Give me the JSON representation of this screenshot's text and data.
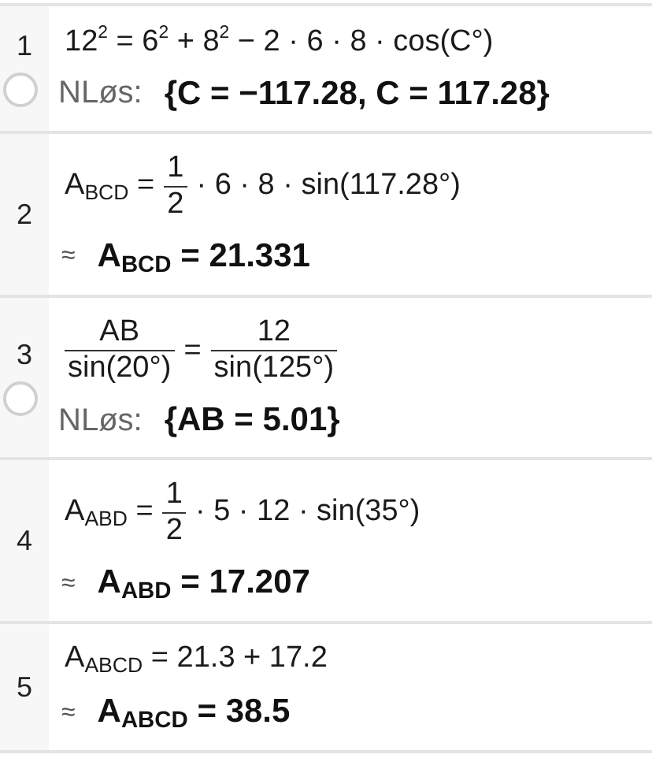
{
  "rows": [
    {
      "number": "1",
      "visibility_toggle": true,
      "input": [
        {
          "kind": "text",
          "text": "12$^{2}$ = 6$^{2}$ + 8$^{2}$ − 2 · 6 · 8 · cos(C°)"
        }
      ],
      "output": {
        "kind": "nsolve",
        "prefix": "NLøs:",
        "value": "{C = −117.28, C = 117.28}"
      }
    },
    {
      "number": "2",
      "visibility_toggle": false,
      "input": [
        {
          "kind": "text",
          "text": "A$_{BCD}$ ="
        },
        {
          "kind": "frac",
          "num": "1",
          "den": "2"
        },
        {
          "kind": "text",
          "text": "· 6 · 8 · sin(117.28°)"
        }
      ],
      "output": {
        "kind": "approx",
        "prefix": "≈",
        "value": "A$_{BCD}$ = 21.331"
      }
    },
    {
      "number": "3",
      "visibility_toggle": true,
      "input": [
        {
          "kind": "frac",
          "num": "AB",
          "den": "sin(20°)"
        },
        {
          "kind": "text",
          "text": "="
        },
        {
          "kind": "frac",
          "num": "12",
          "den": "sin(125°)"
        }
      ],
      "output": {
        "kind": "nsolve",
        "prefix": "NLøs:",
        "value": "{AB = 5.01}"
      }
    },
    {
      "number": "4",
      "visibility_toggle": false,
      "input": [
        {
          "kind": "text",
          "text": "A$_{ABD}$ ="
        },
        {
          "kind": "frac",
          "num": "1",
          "den": "2"
        },
        {
          "kind": "text",
          "text": "· 5 · 12 · sin(35°)"
        }
      ],
      "output": {
        "kind": "approx",
        "prefix": "≈",
        "value": "A$_{ABD}$ = 17.207"
      }
    },
    {
      "number": "5",
      "visibility_toggle": false,
      "input": [
        {
          "kind": "text",
          "text": "A$_{ABCD}$ = 21.3 + 17.2"
        }
      ],
      "output": {
        "kind": "approx",
        "prefix": "≈",
        "value": "A$_{ABCD}$ = 38.5"
      }
    }
  ]
}
